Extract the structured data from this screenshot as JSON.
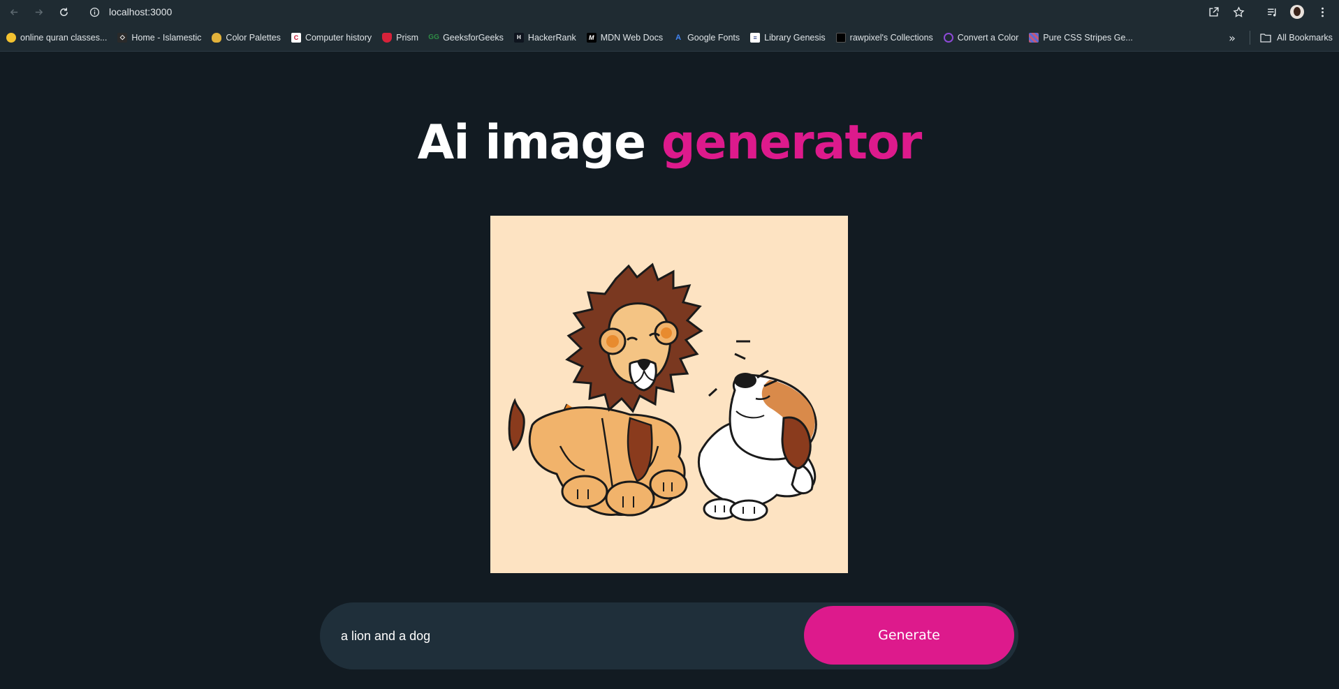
{
  "browser": {
    "url": "localhost:3000",
    "bookmarks": [
      {
        "label": "online quran classes...",
        "icon": "quran-favicon",
        "color": "#f3c230"
      },
      {
        "label": "Home - Islamestic",
        "icon": "islamestic-favicon",
        "color": "#2a2a2a"
      },
      {
        "label": "Color Palettes",
        "icon": "palette-favicon",
        "color": "#e2b23b"
      },
      {
        "label": "Computer history",
        "icon": "computer-history-favicon",
        "color": "#ffffff"
      },
      {
        "label": "Prism",
        "icon": "prism-favicon",
        "color": "#d6223a"
      },
      {
        "label": "GeeksforGeeks",
        "icon": "geeksforgeeks-favicon",
        "color": "#2f8d46"
      },
      {
        "label": "HackerRank",
        "icon": "hackerrank-favicon",
        "color": "#0e141e"
      },
      {
        "label": "MDN Web Docs",
        "icon": "mdn-favicon",
        "color": "#000000"
      },
      {
        "label": "Google Fonts",
        "icon": "google-fonts-favicon",
        "color": "#4285f4"
      },
      {
        "label": "Library Genesis",
        "icon": "library-genesis-favicon",
        "color": "#ffffff"
      },
      {
        "label": "rawpixel's Collections",
        "icon": "rawpixel-favicon",
        "color": "#000000"
      },
      {
        "label": "Convert a Color",
        "icon": "convert-color-favicon",
        "color": "#8d4ad6"
      },
      {
        "label": "Pure CSS Stripes Ge...",
        "icon": "css-stripes-favicon",
        "color": "#c2597a"
      }
    ],
    "all_bookmarks_label": "All Bookmarks"
  },
  "page": {
    "title_part1": "Ai image ",
    "title_part2": "generator",
    "image_alt": "a lion and a dog",
    "prompt_value": "a lion and a dog",
    "generate_label": "Generate"
  },
  "colors": {
    "background": "#121b22",
    "accent": "#dd1a8c",
    "input_bg": "#1f2f3a"
  }
}
